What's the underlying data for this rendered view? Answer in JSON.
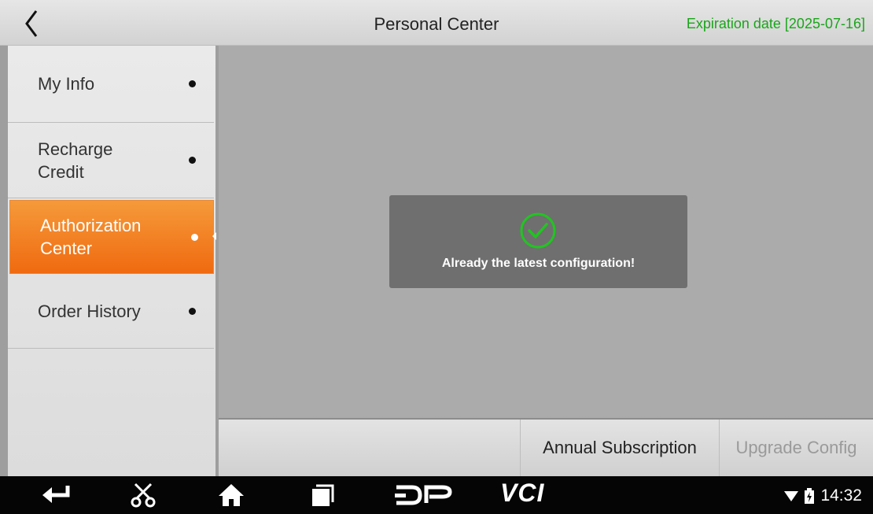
{
  "header": {
    "title": "Personal Center",
    "expiration": "Expiration date [2025-07-16]"
  },
  "sidebar": {
    "items": [
      {
        "label": "My Info",
        "active": false
      },
      {
        "label": "Recharge Credit",
        "active": false
      },
      {
        "label": "Authorization Center",
        "active": true
      },
      {
        "label": "Order History",
        "active": false
      }
    ]
  },
  "toast": {
    "icon": "check-circle-icon",
    "message": "Already the latest configuration!"
  },
  "buttons": {
    "annual_subscription": "Annual Subscription",
    "upgrade_config": "Upgrade Config"
  },
  "navbar": {
    "icons": [
      "back-icon",
      "scissors-icon",
      "home-icon",
      "recent-apps-icon",
      "dp-logo-icon",
      "vci-icon"
    ],
    "vci_label": "VCI",
    "time": "14:32"
  },
  "colors": {
    "accent": "#f07a1c",
    "expiry_green": "#1aa51a",
    "toast_check": "#22c422"
  }
}
